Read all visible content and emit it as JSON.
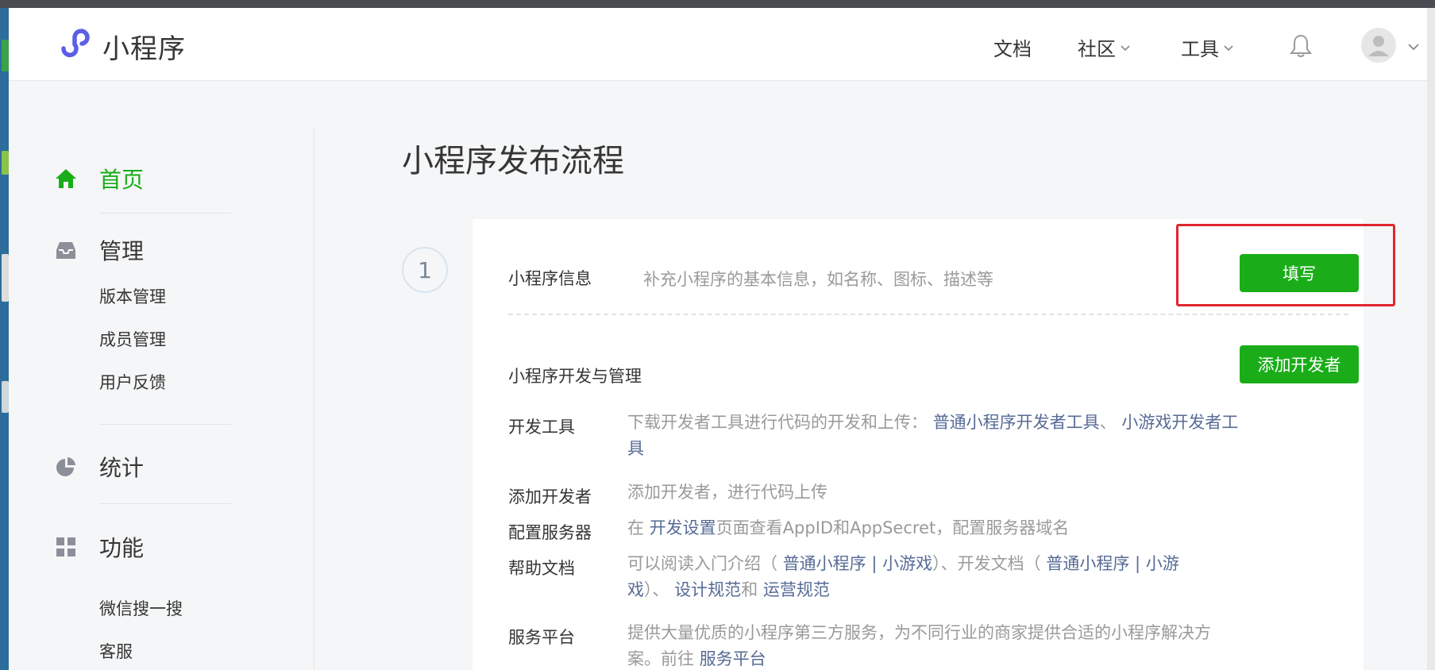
{
  "header": {
    "app_name": "小程序",
    "nav": {
      "docs": "文档",
      "community": "社区",
      "tools": "工具"
    },
    "icons": {
      "logo": "mini-program-logo",
      "bell": "bell-icon",
      "avatar": "user-avatar-icon",
      "chevron": "chevron-down-icon"
    }
  },
  "sidebar": {
    "home": "首页",
    "manage": "管理",
    "manage_items": [
      "版本管理",
      "成员管理",
      "用户反馈"
    ],
    "stats": "统计",
    "features": "功能",
    "feature_items": [
      "微信搜一搜",
      "客服"
    ]
  },
  "main": {
    "title": "小程序发布流程",
    "step_number": "1",
    "info_row": {
      "title": "小程序信息",
      "desc": "补充小程序的基本信息，如名称、图标、描述等",
      "button": "填写"
    },
    "dev_row": {
      "title": "小程序开发与管理",
      "button": "添加开发者"
    },
    "details": [
      {
        "label": "开发工具"
      },
      {
        "label": "添加开发者"
      },
      {
        "label": "配置服务器"
      },
      {
        "label": "帮助文档"
      },
      {
        "label": "服务平台"
      }
    ],
    "texts": {
      "tools_pre": "下载开发者工具进行代码的开发和上传：",
      "tools_link1": "普通小程序开发者工具",
      "tools_sep": "、",
      "tools_link2": "小游戏开发者工具",
      "add_dev": "添加开发者，进行代码上传",
      "server_pre": "在",
      "server_link": "开发设置",
      "server_post": "页面查看AppID和AppSecret，配置服务器域名",
      "help_pre": "可以阅读入门介绍（",
      "help_link1": "普通小程序",
      "help_bar1": "|",
      "help_link2": "小游戏",
      "help_mid": "）、开发文档（",
      "help_link3": "普通小程序",
      "help_bar2": "|",
      "help_link4": "小游戏",
      "help_post": "）、",
      "help_link5": "设计规范",
      "help_and": "和",
      "help_link6": "运营规范",
      "platform_pre": "提供大量优质的小程序第三方服务，为不同行业的商家提供合适的小程序解决方案。前往",
      "platform_link": "服务平台"
    }
  },
  "colors": {
    "brand_green": "#1aad19",
    "link": "#576b95",
    "highlight_red": "#e0262d",
    "logo_purple": "#5b5fe6"
  }
}
